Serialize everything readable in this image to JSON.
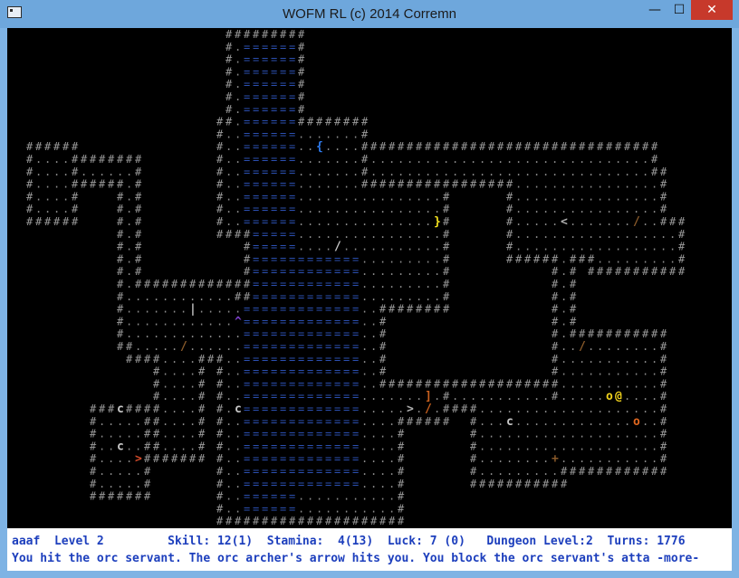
{
  "window": {
    "title": "WOFM RL (c) 2014 Corremn",
    "controls": {
      "minimize": "—",
      "maximize": "☐",
      "close": "✕"
    }
  },
  "map": {
    "wall_glyph": "#",
    "floor_glyph": ".",
    "water_glyph": "=",
    "wall_color": "#9a9a9a",
    "floor_color": "#8c8c8c",
    "water_color": "#2b4fb0",
    "entities": [
      {
        "name": "player",
        "glyph": "@",
        "color": "#f0d21c"
      },
      {
        "name": "orc-servant",
        "glyph": "o",
        "color": "#f0d21c"
      },
      {
        "name": "orc-archer",
        "glyph": "o",
        "color": "#e0671f"
      },
      {
        "name": "cave-creature-1",
        "glyph": "c",
        "color": "#c8c8c8"
      },
      {
        "name": "cave-creature-2",
        "glyph": "c",
        "color": "#c8c8c8"
      },
      {
        "name": "cave-creature-3",
        "glyph": "c",
        "color": "#c8c8c8"
      },
      {
        "name": "cave-creature-4",
        "glyph": "c",
        "color": "#c8c8c8"
      },
      {
        "name": "item-blue-brace",
        "glyph": "{",
        "color": "#2f7cf0"
      },
      {
        "name": "item-yellow-brace",
        "glyph": "}",
        "color": "#f4e21e"
      },
      {
        "name": "item-bracket",
        "glyph": "]",
        "color": "#c8601e"
      },
      {
        "name": "item-wand-1",
        "glyph": "/",
        "color": "#c8c8c8"
      },
      {
        "name": "item-wand-2",
        "glyph": "/",
        "color": "#8a5a2a"
      },
      {
        "name": "item-wand-3",
        "glyph": "/",
        "color": "#8a5a2a"
      },
      {
        "name": "item-wand-4",
        "glyph": "/",
        "color": "#8a5a2a"
      },
      {
        "name": "item-wand-5",
        "glyph": "/",
        "color": "#c8601e"
      },
      {
        "name": "item-bar",
        "glyph": "|",
        "color": "#bdbdbd"
      },
      {
        "name": "trap",
        "glyph": "^",
        "color": "#7a3ec8"
      },
      {
        "name": "stairs-down-1",
        "glyph": ">",
        "color": "#b0b0b0"
      },
      {
        "name": "stairs-down-2",
        "glyph": ">",
        "color": "#d04a2a"
      },
      {
        "name": "stairs-up",
        "glyph": "<",
        "color": "#b0b0b0"
      },
      {
        "name": "item-plus",
        "glyph": "+",
        "color": "#8a5a2a"
      }
    ]
  },
  "status": {
    "line1": "aaaf  Level 2         Skill: 12(1)  Stamina:  4(13)  Luck: 7 (0)   Dungeon Level:2  Turns: 1776",
    "line2": "You hit the orc servant. The orc archer's arrow hits you. You block the orc servant's atta -more-"
  }
}
